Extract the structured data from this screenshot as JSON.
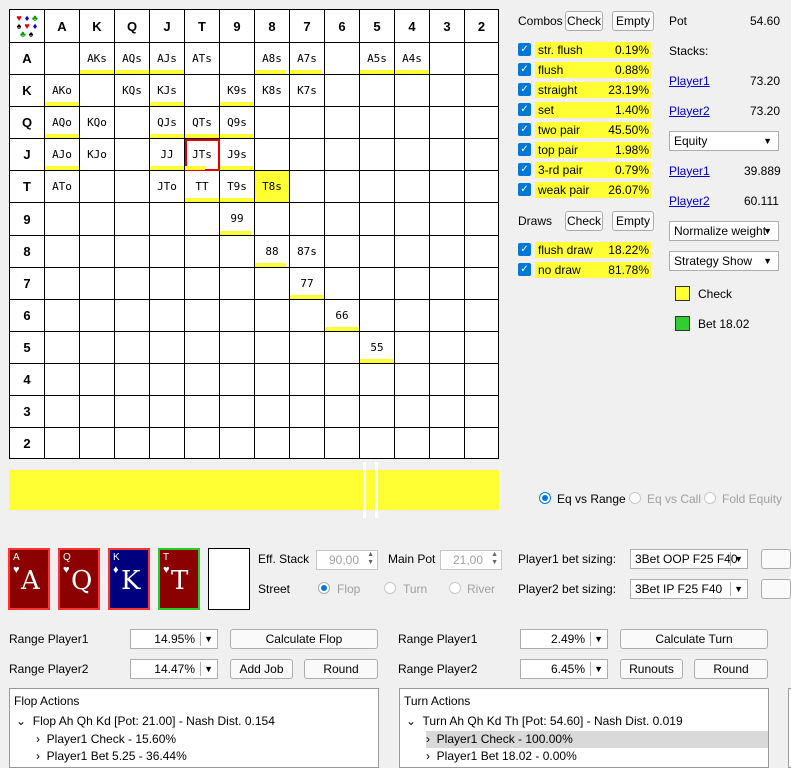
{
  "grid": {
    "ranks": [
      "A",
      "K",
      "Q",
      "J",
      "T",
      "9",
      "8",
      "7",
      "6",
      "5",
      "4",
      "3",
      "2"
    ],
    "corner_suits": [
      "♥",
      "♦",
      "♣",
      "♠",
      "♥",
      "♦",
      "♣",
      "♠"
    ],
    "cells": [
      {
        "label": "AKs",
        "r": 0,
        "c": 1,
        "fill": 1.0
      },
      {
        "label": "AQs",
        "r": 0,
        "c": 2,
        "fill": 1.0
      },
      {
        "label": "AJs",
        "r": 0,
        "c": 3,
        "fill": 1.0
      },
      {
        "label": "ATs",
        "r": 0,
        "c": 4,
        "fill": 0
      },
      {
        "label": "A8s",
        "r": 0,
        "c": 6,
        "fill": 0.9
      },
      {
        "label": "A7s",
        "r": 0,
        "c": 7,
        "fill": 0.9
      },
      {
        "label": "A5s",
        "r": 0,
        "c": 9,
        "fill": 1.0
      },
      {
        "label": "A4s",
        "r": 0,
        "c": 10,
        "fill": 1.0
      },
      {
        "label": "AKo",
        "r": 1,
        "c": 0,
        "fill": 1.0
      },
      {
        "label": "KQs",
        "r": 1,
        "c": 2,
        "fill": 0
      },
      {
        "label": "KJs",
        "r": 1,
        "c": 3,
        "fill": 1.0
      },
      {
        "label": "K9s",
        "r": 1,
        "c": 5,
        "fill": 1.0
      },
      {
        "label": "K8s",
        "r": 1,
        "c": 6,
        "fill": 0
      },
      {
        "label": "K7s",
        "r": 1,
        "c": 7,
        "fill": 0
      },
      {
        "label": "AQo",
        "r": 2,
        "c": 0,
        "fill": 1.0
      },
      {
        "label": "KQo",
        "r": 2,
        "c": 1,
        "fill": 0
      },
      {
        "label": "QJs",
        "r": 2,
        "c": 3,
        "fill": 1.0
      },
      {
        "label": "QTs",
        "r": 2,
        "c": 4,
        "fill": 1.0
      },
      {
        "label": "Q9s",
        "r": 2,
        "c": 5,
        "fill": 1.0
      },
      {
        "label": "AJo",
        "r": 3,
        "c": 0,
        "fill": 1.0
      },
      {
        "label": "KJo",
        "r": 3,
        "c": 1,
        "fill": 0
      },
      {
        "label": "JJ",
        "r": 3,
        "c": 3,
        "fill": 1.0
      },
      {
        "label": "JTs",
        "r": 3,
        "c": 4,
        "fill": 0.6,
        "selected": true
      },
      {
        "label": "J9s",
        "r": 3,
        "c": 5,
        "fill": 1.0
      },
      {
        "label": "ATo",
        "r": 4,
        "c": 0,
        "fill": 0
      },
      {
        "label": "JTo",
        "r": 4,
        "c": 3,
        "fill": 0
      },
      {
        "label": "TT",
        "r": 4,
        "c": 4,
        "fill": 1.0
      },
      {
        "label": "T9s",
        "r": 4,
        "c": 5,
        "fill": 1.0
      },
      {
        "label": "T8s",
        "r": 4,
        "c": 6,
        "full": true
      },
      {
        "label": "99",
        "r": 5,
        "c": 5,
        "fill": 0.9
      },
      {
        "label": "88",
        "r": 6,
        "c": 6,
        "fill": 0.9
      },
      {
        "label": "87s",
        "r": 6,
        "c": 7,
        "fill": 0
      },
      {
        "label": "77",
        "r": 7,
        "c": 7,
        "fill": 1.0
      },
      {
        "label": "66",
        "r": 8,
        "c": 8,
        "fill": 1.0
      },
      {
        "label": "55",
        "r": 9,
        "c": 9,
        "fill": 1.0
      }
    ]
  },
  "combos": {
    "title": "Combos",
    "check_btn": "Check",
    "empty_btn": "Empty",
    "rows": [
      {
        "name": "str. flush",
        "value": "0.19%"
      },
      {
        "name": "flush",
        "value": "0.88%"
      },
      {
        "name": "straight",
        "value": "23.19%"
      },
      {
        "name": "set",
        "value": "1.40%"
      },
      {
        "name": "two pair",
        "value": "45.50%"
      },
      {
        "name": "top pair",
        "value": "1.98%"
      },
      {
        "name": "3-rd pair",
        "value": "0.79%"
      },
      {
        "name": "weak pair",
        "value": "26.07%"
      }
    ]
  },
  "draws": {
    "title": "Draws",
    "check_btn": "Check",
    "empty_btn": "Empty",
    "rows": [
      {
        "name": "flush draw",
        "value": "18.22%"
      },
      {
        "name": "no draw",
        "value": "81.78%"
      }
    ]
  },
  "info": {
    "pot_label": "Pot",
    "pot_value": "54.60",
    "stacks_label": "Stacks:",
    "p1": "Player1",
    "p2": "Player2",
    "p1_stack": "73.20",
    "p2_stack": "73.20",
    "metric_select": "Equity",
    "p1_eq": "39.889",
    "p2_eq": "60.111",
    "normalize_select": "Normalize weight",
    "strategy_select": "Strategy Show",
    "legend_check": "Check",
    "legend_bet": "Bet 18.02",
    "check_color": "#ffff33",
    "bet_color": "#33cc33"
  },
  "radios": {
    "eq_vs_range": "Eq vs Range",
    "eq_vs_call": "Eq vs Call",
    "fold_equity": "Fold Equity"
  },
  "board": {
    "cards": [
      {
        "rank": "A",
        "suit": "♥",
        "bg": "#8b0000"
      },
      {
        "rank": "Q",
        "suit": "♥",
        "bg": "#8b0000"
      },
      {
        "rank": "K",
        "suit": "♦",
        "bg": "#00007f"
      },
      {
        "rank": "T",
        "suit": "♥",
        "bg": "#8b0000"
      }
    ]
  },
  "settings": {
    "eff_stack_label": "Eff. Stack",
    "eff_stack_value": "90,00",
    "main_pot_label": "Main Pot",
    "main_pot_value": "21,00",
    "street_label": "Street",
    "flop": "Flop",
    "turn": "Turn",
    "river": "River",
    "p1_bet_label": "Player1 bet sizing:",
    "p1_bet_value": "3Bet OOP F25 F40",
    "p2_bet_label": "Player2 bet sizing:",
    "p2_bet_value": "3Bet IP F25 F40"
  },
  "flop_ctrl": {
    "range_p1_label": "Range Player1",
    "range_p1_value": "14.95%",
    "range_p2_label": "Range Player2",
    "range_p2_value": "14.47%",
    "calc_btn": "Calculate Flop",
    "add_job_btn": "Add Job",
    "round_btn": "Round"
  },
  "turn_ctrl": {
    "range_p1_label": "Range Player1",
    "range_p1_value": "2.49%",
    "range_p2_label": "Range Player2",
    "range_p2_value": "6.45%",
    "calc_btn": "Calculate Turn",
    "runouts_btn": "Runouts",
    "round_btn": "Round"
  },
  "flop_actions": {
    "title": "Flop Actions",
    "root": "Flop Ah Qh Kd [Pot: 21.00] - Nash Dist. 0.154",
    "items": [
      "Player1 Check - 15.60%",
      "Player1 Bet 5.25 - 36.44%"
    ]
  },
  "turn_actions": {
    "title": "Turn Actions",
    "root": "Turn Ah Qh Kd Th [Pot: 54.60] - Nash Dist. 0.019",
    "items": [
      "Player1 Check - 100.00%",
      "Player1 Bet 18.02 - 0.00%"
    ]
  }
}
